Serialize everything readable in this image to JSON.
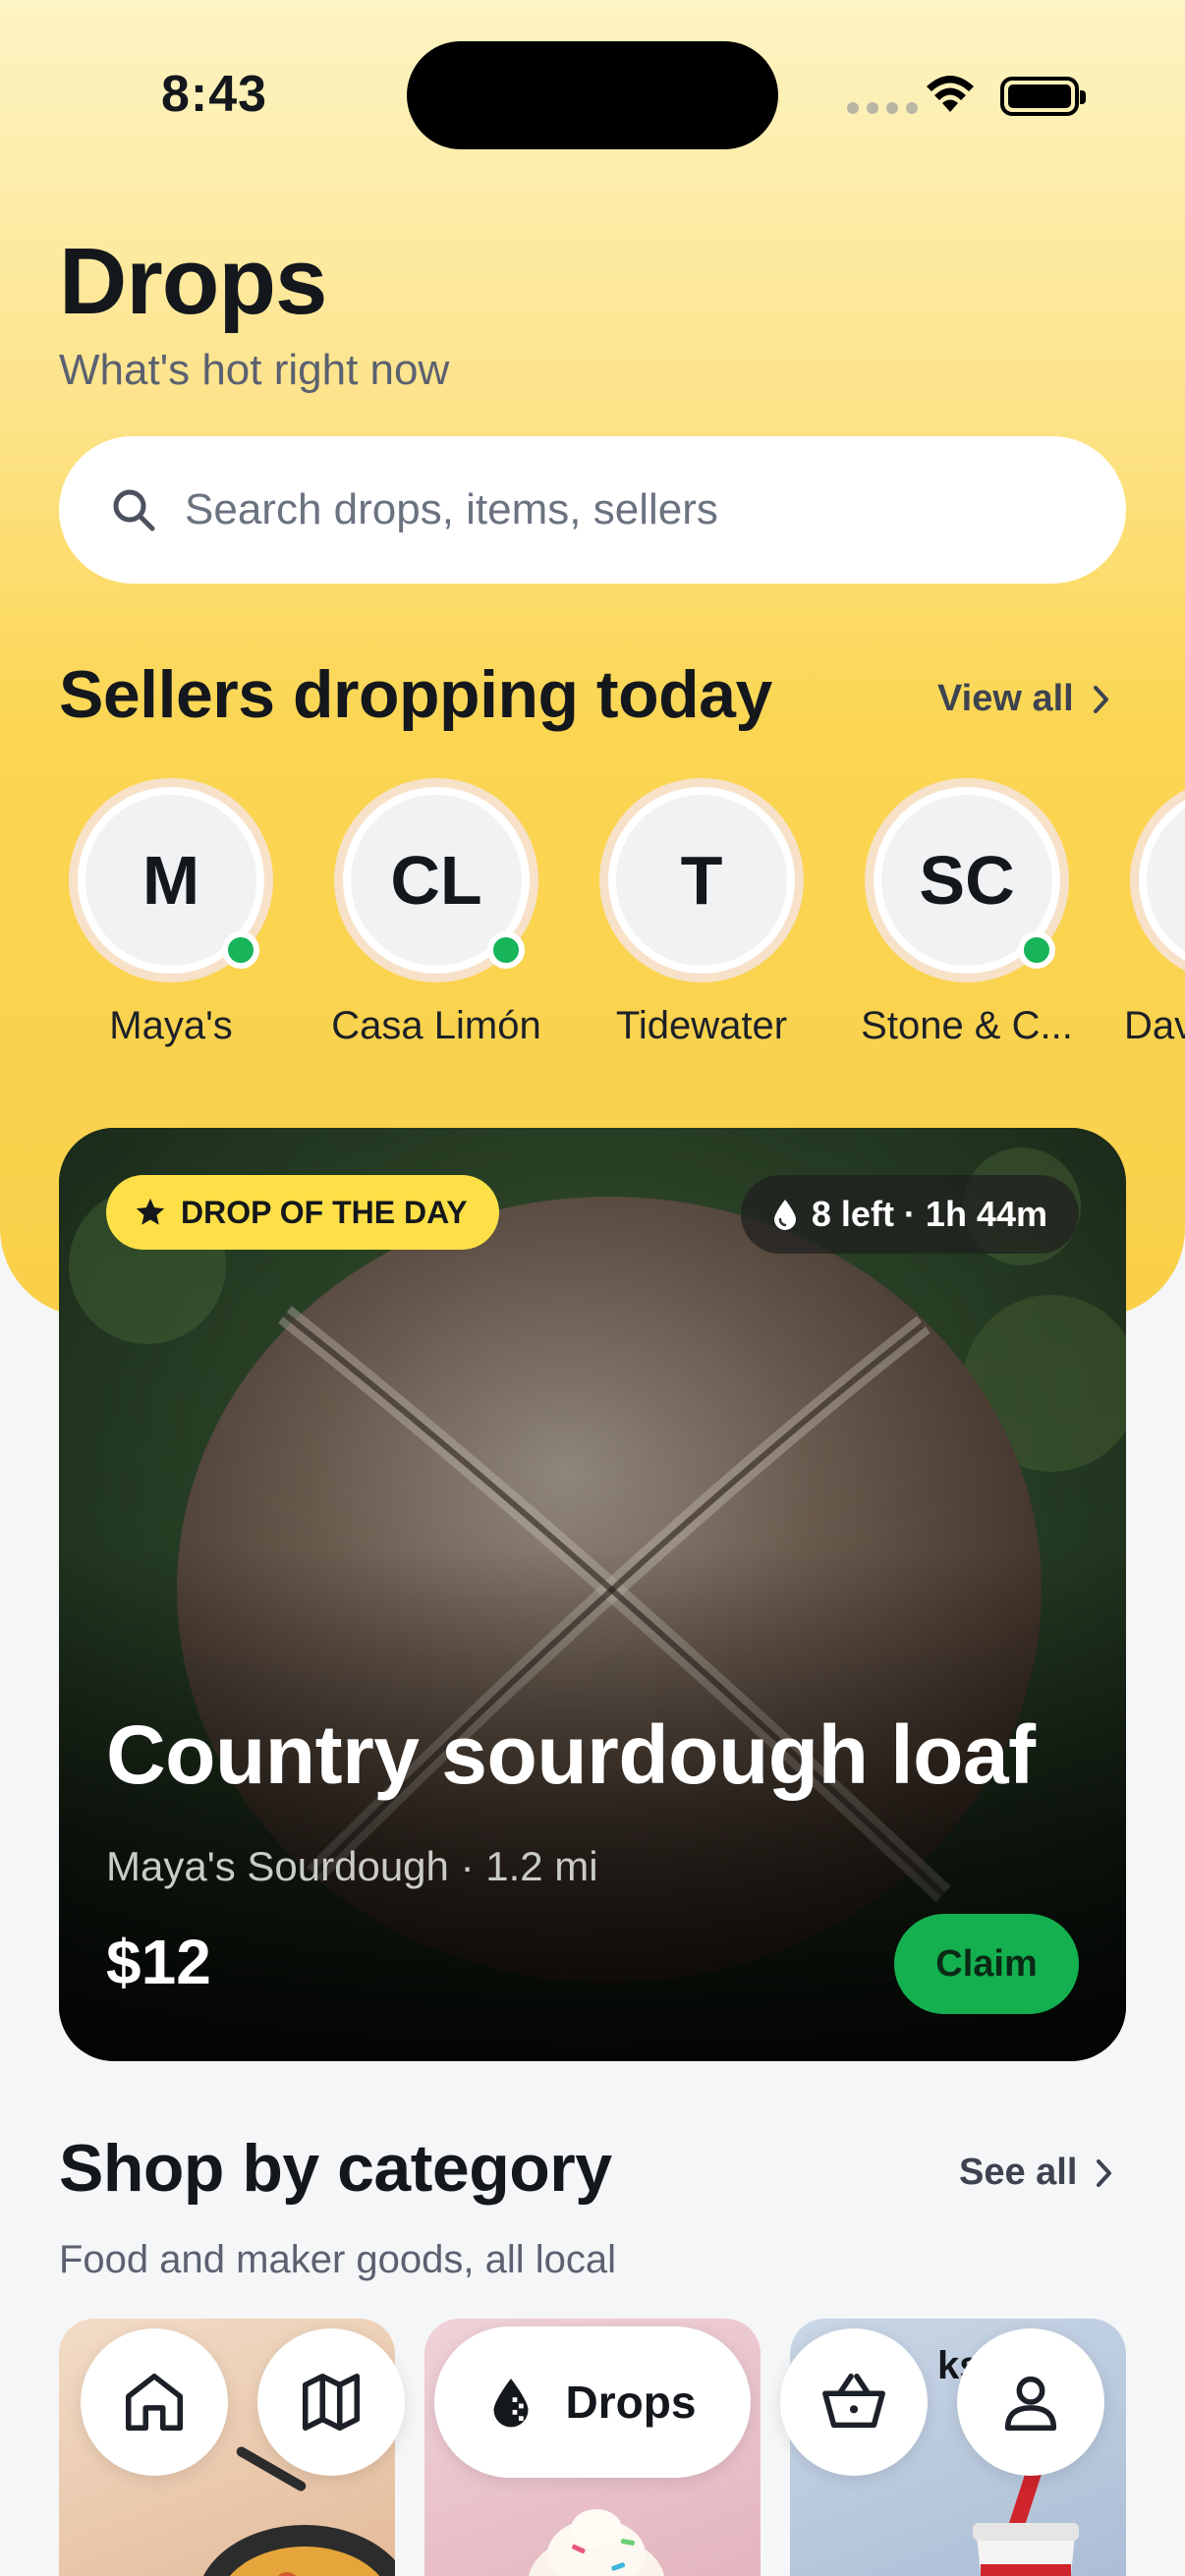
{
  "status_bar": {
    "time": "8:43"
  },
  "header": {
    "title": "Drops",
    "subtitle": "What's hot right now"
  },
  "search": {
    "placeholder": "Search drops, items, sellers",
    "icon": "search-icon"
  },
  "sellers_section": {
    "title": "Sellers dropping today",
    "view_all_label": "View all",
    "sellers": [
      {
        "initials": "M",
        "name": "Maya's",
        "online": true
      },
      {
        "initials": "CL",
        "name": "Casa Limón",
        "online": true
      },
      {
        "initials": "T",
        "name": "Tidewater",
        "online": false
      },
      {
        "initials": "SC",
        "name": "Stone & C...",
        "online": true
      },
      {
        "initials": "",
        "name": "Dav",
        "online": false
      }
    ]
  },
  "featured_drop": {
    "badge": "DROP OF THE DAY",
    "stock_time": "8 left · 1h 44m",
    "title": "Country sourdough loaf",
    "meta": "Maya's Sourdough · 1.2 mi",
    "price": "$12",
    "cta": "Claim"
  },
  "categories_section": {
    "title": "Shop by category",
    "see_all_label": "See all",
    "subtitle": "Food and maker goods, all local",
    "partial_label": "ks"
  },
  "bottom_nav": {
    "items": [
      {
        "icon": "home-icon"
      },
      {
        "icon": "map-icon"
      },
      {
        "icon": "drops-icon",
        "label": "Drops",
        "active": true
      },
      {
        "icon": "basket-icon"
      },
      {
        "icon": "profile-icon"
      }
    ]
  },
  "colors": {
    "accent_yellow": "#fde047",
    "online_green": "#17b45a",
    "claim_green": "#14b04f"
  }
}
